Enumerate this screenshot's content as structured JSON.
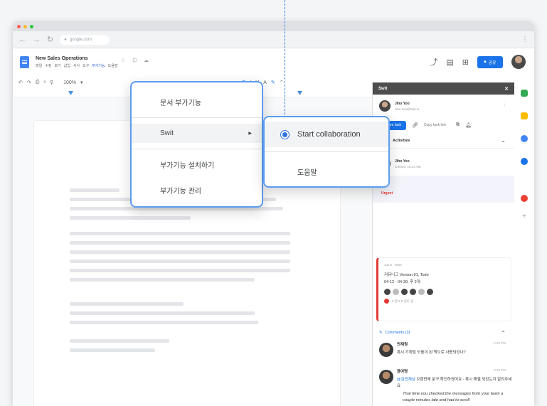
{
  "browser": {
    "url": "google.com",
    "menu_icon": "kebab-icon",
    "colors": {
      "close": "#ff5f57",
      "minimize": "#febc2e",
      "zoom": "#28c840"
    }
  },
  "doc": {
    "title": "New Sales Operations",
    "menus": [
      "파일",
      "수정",
      "보기",
      "삽입",
      "서식",
      "도구",
      "부가기능",
      "도움말"
    ],
    "active_menu_index": 6
  },
  "header": {
    "share_label": "공유"
  },
  "toolbar": {
    "zoom": "100%"
  },
  "context_menu": {
    "items": [
      {
        "label": "문서 부가기능"
      },
      {
        "label": "Swit",
        "has_submenu": true
      },
      {
        "label": "부가기능 설치하기"
      },
      {
        "label": "부가기능 관리"
      }
    ]
  },
  "submenu": {
    "items": [
      {
        "label": "Start collaboration"
      },
      {
        "label": "도움말"
      }
    ]
  },
  "swit_panel": {
    "title": "Swit",
    "user": {
      "name": "Jiho Yoo",
      "subtitle": "Jiho Yoo@swit.io"
    },
    "actions": {
      "primary": "Share task",
      "link": "Copy task link"
    },
    "section_title": "Activities",
    "message_user": {
      "name": "Jiho Yoo",
      "time": "4/30/20, 10:14 AM"
    },
    "flag": "Urgent",
    "card": {
      "meta": "Jun 5 · Mine",
      "lines": [
        "커뮤니그 Version 01, Todo",
        "04-12 - 04-30, 후 2개"
      ],
      "vote_text": "2 명 2.0 검토 중"
    },
    "comments": {
      "title": "Comments (3)",
      "items": [
        {
          "name": "안재원",
          "time": "2:45 PM",
          "body": "혹시 기획팀 도움이 된 책으로 사용되었나?"
        },
        {
          "name": "윤여명",
          "time": "2:46 PM",
          "highlight": "@김민재님",
          "body": "오랜만에 문구 확인하였어요 - 혹시 해결 되었는지 알려주세요",
          "quote": "That time you checked the messages from your team a couple minutes late and had to scroll"
        }
      ]
    }
  },
  "accent": "#1a73e8",
  "callout_color": "#3a7be0"
}
